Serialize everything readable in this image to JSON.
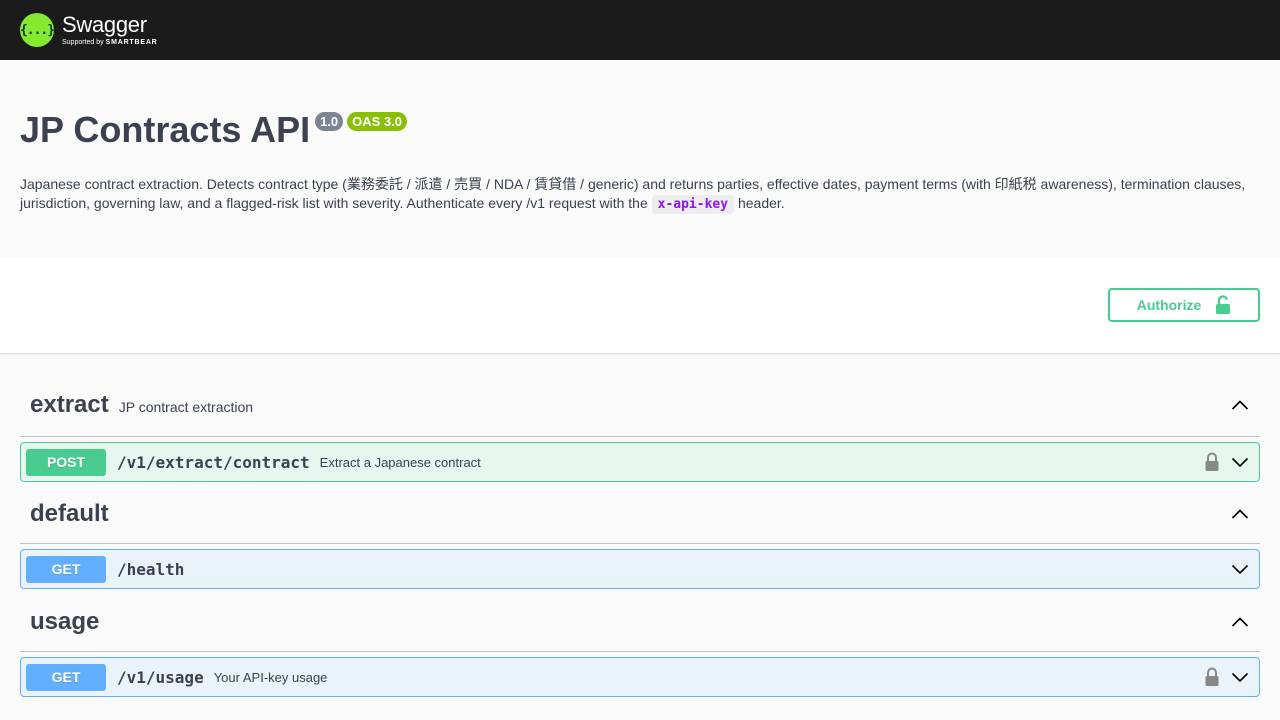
{
  "topbar": {
    "logo_mark": "{...}",
    "logo_name": "Swagger",
    "logo_sub_prefix": "Supported by",
    "logo_sub_brand": "SMARTBEAR"
  },
  "info": {
    "title": "JP Contracts API",
    "version": "1.0",
    "oas": "OAS 3.0",
    "desc_before": "Japanese contract extraction. Detects contract type (業務委託 / 派遣 / 売買 / NDA / 賃貸借 / generic) and returns parties, effective dates, payment terms (with 印紙税 awareness), termination clauses, jurisdiction, governing law, and a flagged-risk list with severity. Authenticate every /v1 request with the ",
    "desc_code": "x-api-key",
    "desc_after": " header."
  },
  "scheme": {
    "authorize_label": "Authorize"
  },
  "tags": [
    {
      "name": "extract",
      "description": "JP contract extraction",
      "operations": [
        {
          "method": "POST",
          "path": "/v1/extract/contract",
          "summary": "Extract a Japanese contract",
          "locked": true
        }
      ]
    },
    {
      "name": "default",
      "description": "",
      "operations": [
        {
          "method": "GET",
          "path": "/health",
          "summary": "",
          "locked": false
        }
      ]
    },
    {
      "name": "usage",
      "description": "",
      "operations": [
        {
          "method": "GET",
          "path": "/v1/usage",
          "summary": "Your API-key usage",
          "locked": true
        }
      ]
    }
  ],
  "colors": {
    "post": "#49cc90",
    "get": "#61affe",
    "topbar": "#1b1b1b",
    "logo": "#85ea2d",
    "version_badge": "#7d8492",
    "oas_badge": "#89bf04"
  },
  "icons": {
    "unlock": "unlock-icon",
    "lock": "lock-icon",
    "collapse": "chevron-up-icon",
    "expand": "chevron-down-icon"
  }
}
